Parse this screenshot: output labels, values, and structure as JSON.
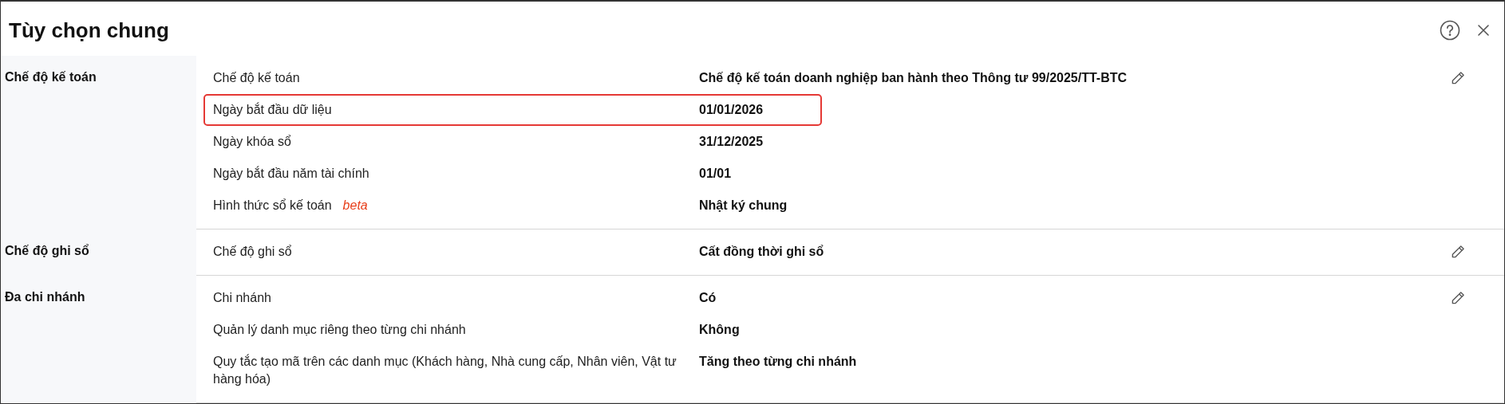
{
  "window": {
    "title": "Tùy chọn chung"
  },
  "sections": [
    {
      "heading": "Chế độ kế toán",
      "editable": true,
      "rows": [
        {
          "label": "Chế độ kế toán",
          "value": "Chế độ kế toán doanh nghiệp ban hành theo Thông tư 99/2025/TT-BTC",
          "highlighted": false
        },
        {
          "label": "Ngày bắt đầu dữ liệu",
          "value": "01/01/2026",
          "highlighted": true
        },
        {
          "label": "Ngày khóa sổ",
          "value": "31/12/2025",
          "highlighted": false
        },
        {
          "label": "Ngày bắt đầu năm tài chính",
          "value": "01/01",
          "highlighted": false
        },
        {
          "label": "Hình thức sổ kế toán",
          "tag": "beta",
          "value": "Nhật ký chung",
          "highlighted": false
        }
      ]
    },
    {
      "heading": "Chế độ ghi sổ",
      "editable": true,
      "rows": [
        {
          "label": "Chế độ ghi sổ",
          "value": "Cất đồng thời ghi sổ",
          "highlighted": false
        }
      ]
    },
    {
      "heading": "Đa chi nhánh",
      "editable": true,
      "rows": [
        {
          "label": "Chi nhánh",
          "value": "Có",
          "highlighted": false
        },
        {
          "label": "Quản lý danh mục riêng theo từng chi nhánh",
          "value": "Không",
          "highlighted": false
        },
        {
          "label": "Quy tắc tạo mã trên các danh mục (Khách hàng, Nhà cung cấp, Nhân viên, Vật tư hàng hóa)",
          "value": "Tăng theo từng chi nhánh",
          "highlighted": false
        }
      ]
    }
  ]
}
